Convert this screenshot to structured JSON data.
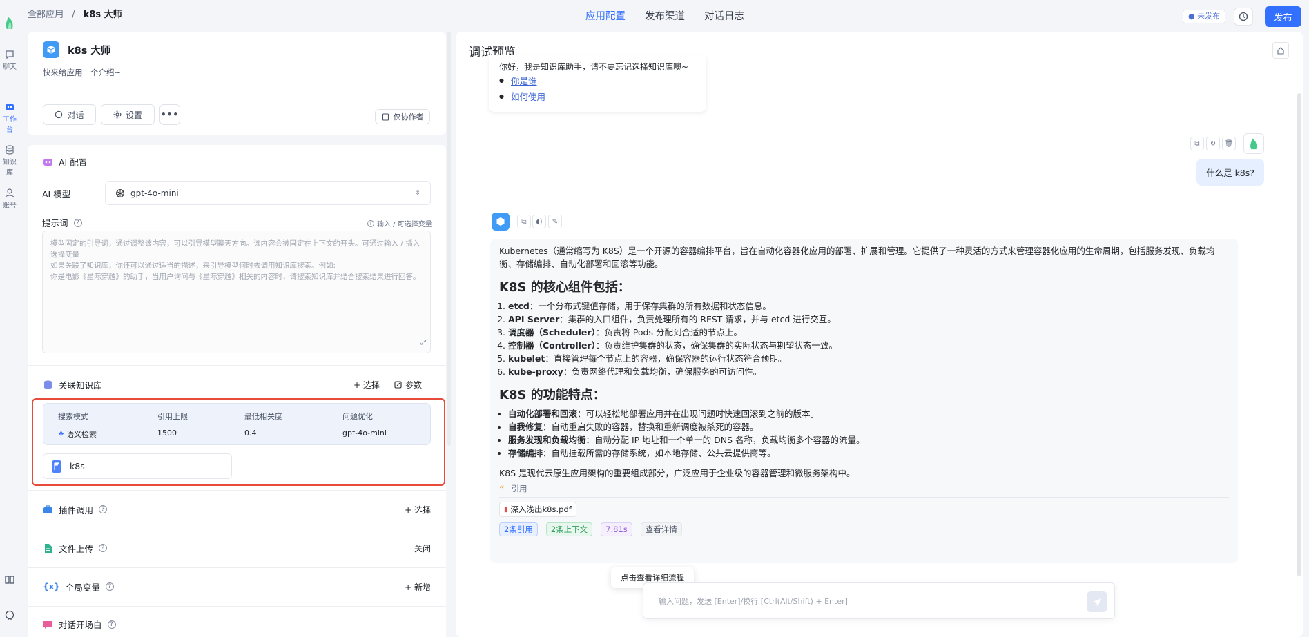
{
  "nav": {
    "breadcrumb_root": "全部应用",
    "breadcrumb_sep": "/",
    "breadcrumb_current": "k8s 大师",
    "tabs": [
      "应用配置",
      "发布渠道",
      "对话日志"
    ],
    "status_badge": "● 未发布",
    "publish_button": "发布"
  },
  "rail": {
    "items": [
      "聊天",
      "工作台",
      "知识库",
      "账号"
    ]
  },
  "app": {
    "name": "k8s 大师",
    "intro": "快来给应用一个介绍~",
    "chat_button": "对话",
    "settings_button": "设置",
    "author_only": "仅协作者"
  },
  "ai_config": {
    "title": "AI 配置",
    "model_label": "AI 模型",
    "model_value": "gpt-4o-mini",
    "prompt_label": "提示词",
    "prompt_var_hint": "输入 / 可选择变量",
    "prompt_placeholder_1": "模型固定的引导词，通过调整该内容，可以引导模型聊天方向。该内容会被固定在上下文的开头。可通过输入 / 插入选择变量",
    "prompt_placeholder_2": "如果关联了知识库，你还可以通过适当的描述，来引导模型何时去调用知识库搜索。例如:",
    "prompt_placeholder_3": "你是电影《星际穿越》的助手，当用户询问与《星际穿越》相关的内容时，请搜索知识库并结合搜索结果进行回答。"
  },
  "kb": {
    "title": "关联知识库",
    "select_button": "+ 选择",
    "params_button": "参数",
    "headers": [
      "搜索模式",
      "引用上限",
      "最低相关度",
      "问题优化"
    ],
    "values": [
      "语义检索",
      "1500",
      "0.4",
      "gpt-4o-mini"
    ],
    "dataset_name": "k8s"
  },
  "sections": {
    "plugin": {
      "label": "插件调用",
      "action": "+ 选择"
    },
    "file_upload": {
      "label": "文件上传",
      "action": "关闭"
    },
    "global_vars": {
      "label": "全局变量",
      "action": "+ 新增"
    },
    "opening": {
      "label": "对话开场白"
    }
  },
  "preview": {
    "title": "调试预览",
    "welcome": "你好，我是知识库助手，请不要忘记选择知识库噢~",
    "welcome_links": [
      "你是谁",
      "如何使用"
    ],
    "user_question": "什么是 k8s?",
    "answer_intro": "Kubernetes（通常缩写为 K8S）是一个开源的容器编排平台，旨在自动化容器化应用的部署、扩展和管理。它提供了一种灵活的方式来管理容器化应用的生命周期，包括服务发现、负载均衡、存储编排、自动化部署和回滚等功能。",
    "h_components": "K8S 的核心组件包括：",
    "components": [
      {
        "name": "etcd",
        "desc": "：一个分布式键值存储，用于保存集群的所有数据和状态信息。"
      },
      {
        "name": "API Server",
        "desc": "：集群的入口组件，负责处理所有的 REST 请求，并与 etcd 进行交互。"
      },
      {
        "name": "调度器（Scheduler）",
        "desc": "：负责将 Pods 分配到合适的节点上。"
      },
      {
        "name": "控制器（Controller）",
        "desc": "：负责维护集群的状态，确保集群的实际状态与期望状态一致。"
      },
      {
        "name": "kubelet",
        "desc": "：直接管理每个节点上的容器，确保容器的运行状态符合预期。"
      },
      {
        "name": "kube-proxy",
        "desc": "：负责网络代理和负载均衡，确保服务的可访问性。"
      }
    ],
    "h_features": "K8S 的功能特点：",
    "features": [
      {
        "name": "自动化部署和回滚",
        "desc": "：可以轻松地部署应用并在出现问题时快速回滚到之前的版本。"
      },
      {
        "name": "自我修复",
        "desc": "：自动重启失败的容器，替换和重新调度被杀死的容器。"
      },
      {
        "name": "服务发现和负载均衡",
        "desc": "：自动分配 IP 地址和一个单一的 DNS 名称，负载均衡多个容器的流量。"
      },
      {
        "name": "存储编排",
        "desc": "：自动挂载所需的存储系统，如本地存储、公共云提供商等。"
      }
    ],
    "answer_outro": "K8S 是现代云原生应用架构的重要组成部分，广泛应用于企业级的容器管理和微服务架构中。",
    "quote_label": "引用",
    "quote_file": "深入浅出k8s.pdf",
    "tags": [
      "2条引用",
      "2条上下文",
      "7.81s",
      "查看详情"
    ],
    "tooltip": "点击查看详细流程",
    "input_placeholder": "输入问题，发送 [Enter]/换行 [Ctrl(Alt/Shift) + Enter]"
  },
  "colors": {
    "accent": "#3370ff",
    "highlight_border": "#e84a3c"
  }
}
